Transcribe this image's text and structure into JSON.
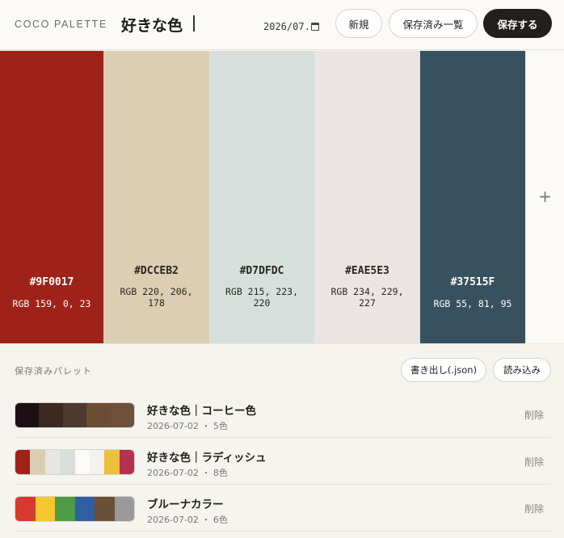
{
  "header": {
    "brand": "COCO PALETTE",
    "palette_name": "好きな色",
    "date_value": "2026/07.",
    "new_label": "新規",
    "saved_list_label": "保存済み一覧",
    "save_label": "保存する"
  },
  "swatches": [
    {
      "hex": "#9F0017",
      "rgb": "RGB 159, 0, 23",
      "color": "#9F2218",
      "text_color": "#ffffff"
    },
    {
      "hex": "#DCCEB2",
      "rgb": "RGB 220, 206, 178",
      "color": "#DCCEB2",
      "text_color": "#2a2620"
    },
    {
      "hex": "#D7DFDC",
      "rgb": "RGB 215, 223, 220",
      "color": "#D7DFDC",
      "text_color": "#2a2620"
    },
    {
      "hex": "#EAE5E3",
      "rgb": "RGB 234, 229, 227",
      "color": "#EAE5E3",
      "text_color": "#2a2620"
    },
    {
      "hex": "#37515F",
      "rgb": "RGB 55, 81, 95",
      "color": "#37515F",
      "text_color": "#ffffff"
    }
  ],
  "add_color": {
    "icon": "plus-icon",
    "glyph": "+"
  },
  "saved": {
    "heading": "保存済みパレット",
    "export_label": "書き出し(.json)",
    "import_label": "読み込み",
    "palettes": [
      {
        "name": "好きな色｜コーヒー色",
        "meta": "2026-07-02 ・ 5色",
        "delete_label": "削除",
        "colors": [
          "#1c1014",
          "#3c2a22",
          "#4c3a30",
          "#6b4c34",
          "#6f4e3c"
        ]
      },
      {
        "name": "好きな色｜ラディッシュ",
        "meta": "2026-07-02 ・ 8色",
        "delete_label": "削除",
        "colors": [
          "#9F2218",
          "#DCCEB2",
          "#e8e6e4",
          "#D7DFDC",
          "#fbfbf8",
          "#f2f2f0",
          "#eebf3a",
          "#b3324f"
        ]
      },
      {
        "name": "ブルーナカラー",
        "meta": "2026-07-02 ・ 6色",
        "delete_label": "削除",
        "colors": [
          "#d63a2f",
          "#f6c62f",
          "#4c9c45",
          "#2f5fa3",
          "#6b5038",
          "#9a9a9a"
        ]
      }
    ]
  }
}
